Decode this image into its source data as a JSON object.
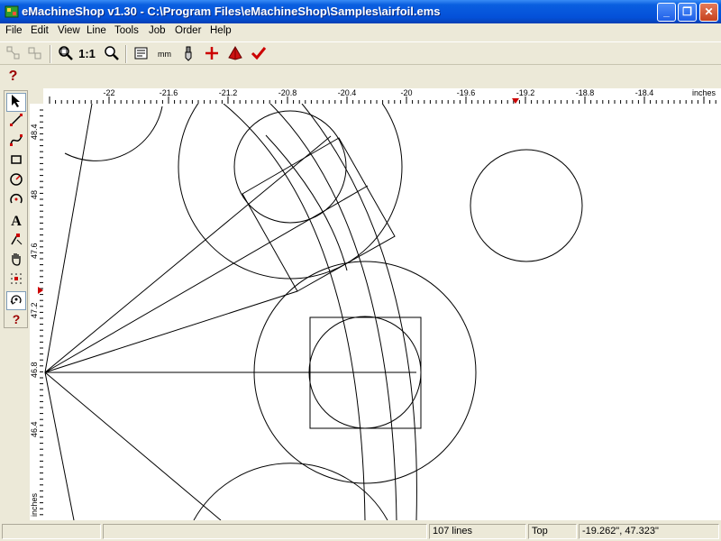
{
  "window": {
    "title": "eMachineShop v1.30 - C:\\Program Files\\eMachineShop\\Samples\\airfoil.ems",
    "minimize": "_",
    "maximize": "❐",
    "close": "✕"
  },
  "menu": [
    "File",
    "Edit",
    "View",
    "Line",
    "Tools",
    "Job",
    "Order",
    "Help"
  ],
  "toolbar": {
    "zoom_1to1": "1:1",
    "units_label": "mm"
  },
  "help_glyph": "?",
  "palette": {
    "text_tool": "A",
    "help": "?"
  },
  "ruler": {
    "x_ticks": [
      "-22",
      "-21.6",
      "-21.2",
      "-20.8",
      "-20.4",
      "-20",
      "-19.6",
      "-19.2",
      "-18.8",
      "-18.4"
    ],
    "x_unit": "inches",
    "y_ticks": [
      "48.4",
      "48",
      "47.6",
      "47.2",
      "46.8",
      "46.4"
    ],
    "y_unit": "inches"
  },
  "status": {
    "line_count": "107 lines",
    "view": "Top",
    "coords": "-19.262\", 47.323\""
  },
  "colors": {
    "title_bar": "#0a5fe0",
    "chrome": "#ece9d8",
    "accent_red": "#cc0000"
  }
}
